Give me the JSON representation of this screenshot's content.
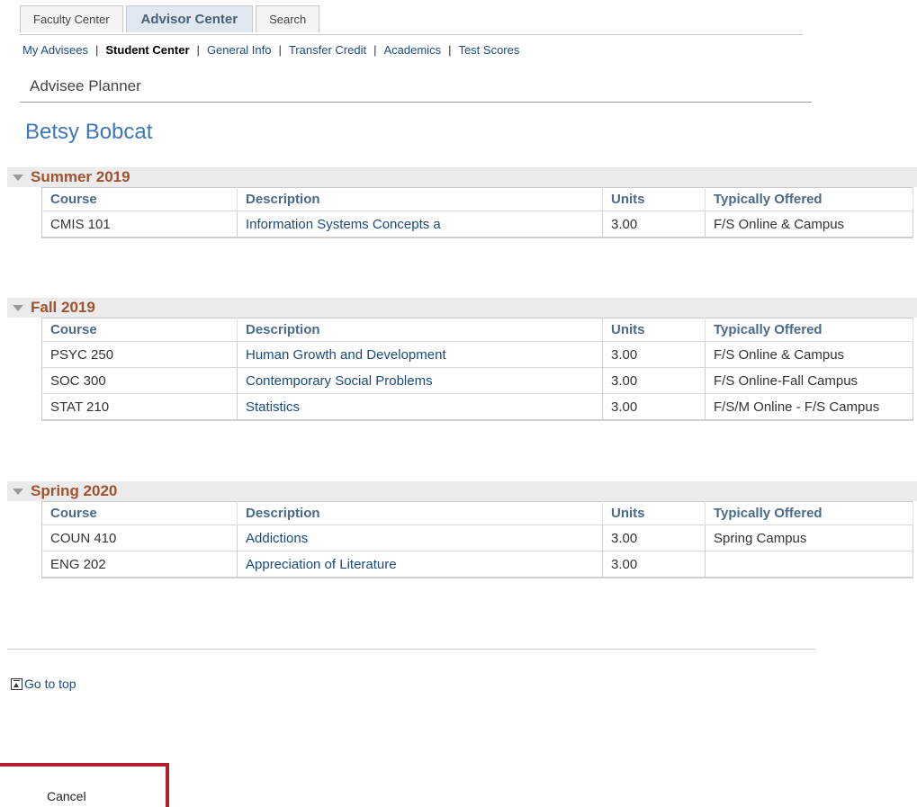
{
  "tabs": [
    {
      "label": "Faculty Center"
    },
    {
      "label": "Advisor Center"
    },
    {
      "label": "Search"
    }
  ],
  "subnav": [
    {
      "label": "My Advisees"
    },
    {
      "label": "Student Center"
    },
    {
      "label": "General Info"
    },
    {
      "label": "Transfer Credit"
    },
    {
      "label": "Academics"
    },
    {
      "label": "Test Scores"
    }
  ],
  "page_title": "Advisee Planner",
  "student_name": "Betsy Bobcat",
  "columns": {
    "course": "Course",
    "description": "Description",
    "units": "Units",
    "offered": "Typically Offered"
  },
  "terms": [
    {
      "name": "Summer 2019",
      "rows": [
        {
          "course": "CMIS 101",
          "description": "Information Systems Concepts a",
          "units": "3.00",
          "offered": "F/S Online & Campus"
        }
      ]
    },
    {
      "name": "Fall 2019",
      "rows": [
        {
          "course": "PSYC 250",
          "description": "Human Growth and Development",
          "units": "3.00",
          "offered": "F/S Online & Campus"
        },
        {
          "course": "SOC 300",
          "description": "Contemporary Social Problems",
          "units": "3.00",
          "offered": "F/S Online-Fall Campus"
        },
        {
          "course": "STAT 210",
          "description": "Statistics",
          "units": "3.00",
          "offered": "F/S/M Online - F/S Campus"
        }
      ]
    },
    {
      "name": "Spring 2020",
      "rows": [
        {
          "course": "COUN 410",
          "description": "Addictions",
          "units": "3.00",
          "offered": "Spring Campus"
        },
        {
          "course": "ENG 202",
          "description": "Appreciation of Literature",
          "units": "3.00",
          "offered": ""
        }
      ]
    }
  ],
  "go_to_top": "Go to top",
  "cancel_label": "Cancel",
  "colors": {
    "accent_link": "#1a4b80",
    "student_name": "#3b77b9",
    "term_title": "#a0522d",
    "highlight_frame": "#b01e2e"
  }
}
